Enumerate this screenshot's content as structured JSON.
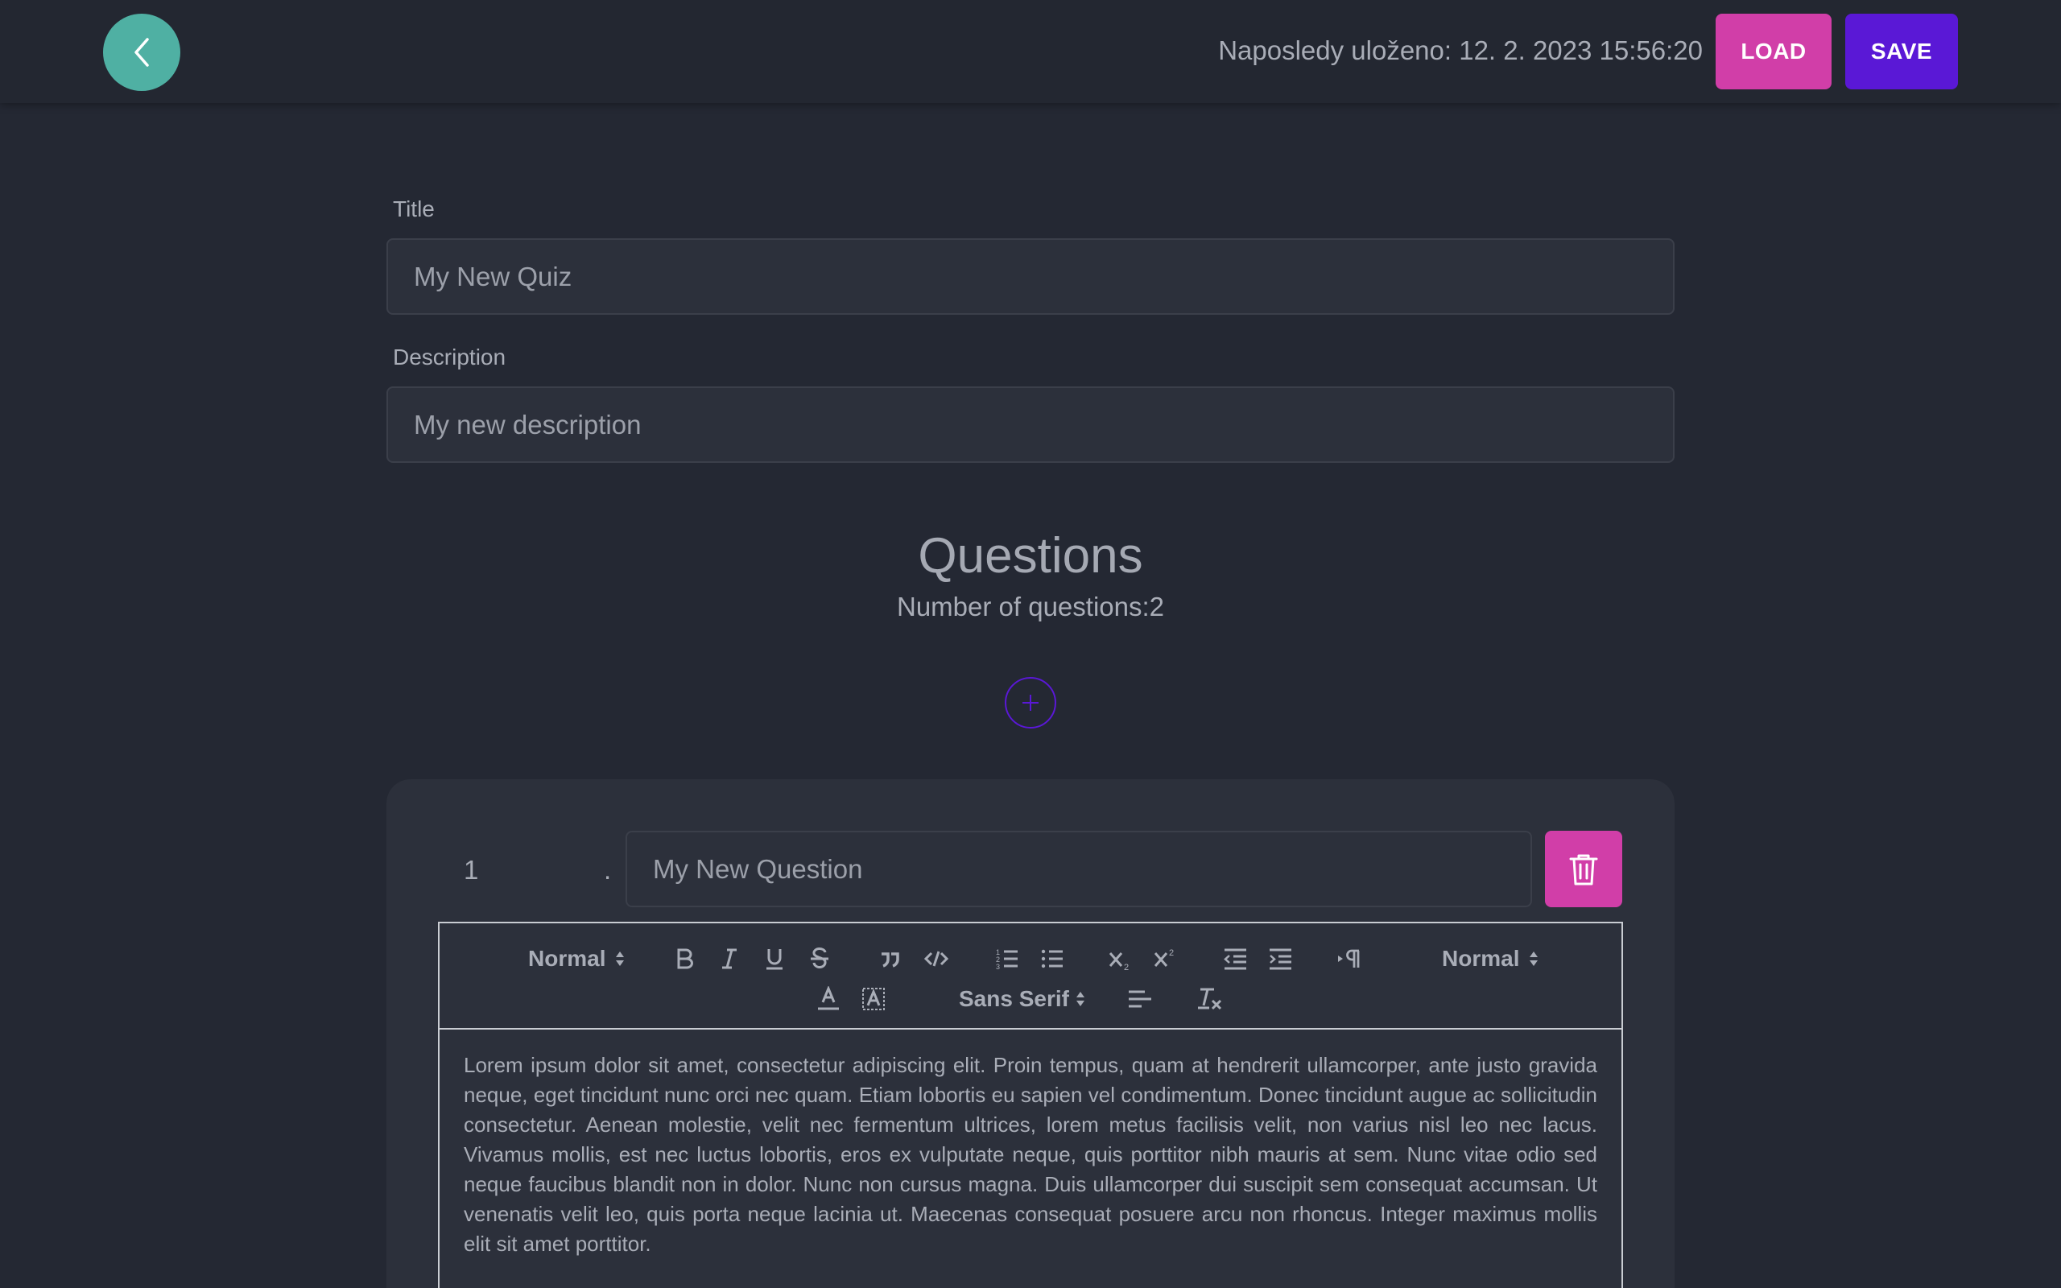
{
  "header": {
    "last_saved": "Naposledy uloženo: 12. 2. 2023 15:56:20",
    "load_label": "LOAD",
    "save_label": "SAVE"
  },
  "form": {
    "title_label": "Title",
    "title_value": "My New Quiz",
    "description_label": "Description",
    "description_value": "My new description"
  },
  "questions": {
    "heading": "Questions",
    "count_text": "Number of questions:2",
    "items": [
      {
        "number": "1",
        "dot": ".",
        "title": "My New Question",
        "toolbar": {
          "header_select": "Normal",
          "size_select": "Normal",
          "font_select": "Sans Serif"
        },
        "body": "Lorem ipsum dolor sit amet, consectetur adipiscing elit. Proin tempus, quam at hendrerit ullamcorper, ante justo gravida neque, eget tincidunt nunc orci nec quam. Etiam lobortis eu sapien vel condimentum. Donec tincidunt augue ac sollicitudin consectetur. Aenean molestie, velit nec fermentum ultrices, lorem metus facilisis velit, non varius nisl leo nec lacus. Vivamus mollis, est nec luctus lobortis, eros ex vulputate neque, quis porttitor nibh mauris at sem. Nunc vitae odio sed neque faucibus blandit non in dolor. Nunc non cursus magna. Duis ullamcorper dui suscipit sem consequat accumsan. Ut venenatis velit leo, quis porta neque lacinia ut. Maecenas consequat posuere arcu non rhoncus. Integer maximus mollis elit sit amet porttitor."
      }
    ]
  },
  "colors": {
    "background": "#242833",
    "accent_teal": "#4fb0a3",
    "accent_pink": "#d13ea8",
    "accent_purple": "#5a18d6"
  },
  "icons": [
    "chevron-left-icon",
    "plus-icon",
    "trash-icon",
    "bold-icon",
    "italic-icon",
    "underline-icon",
    "strike-icon",
    "blockquote-icon",
    "code-icon",
    "ordered-list-icon",
    "bullet-list-icon",
    "subscript-icon",
    "superscript-icon",
    "outdent-icon",
    "indent-icon",
    "direction-icon",
    "text-color-icon",
    "background-color-icon",
    "align-icon",
    "clear-format-icon"
  ]
}
